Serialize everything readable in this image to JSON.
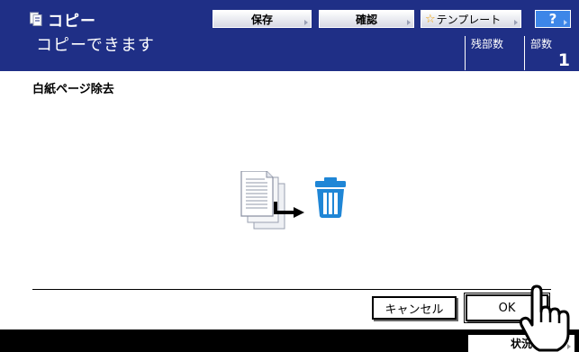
{
  "header": {
    "app_title": "コピー",
    "status_message": "コピーできます",
    "buttons": {
      "save": "保存",
      "check": "確認",
      "template_star": "☆",
      "template": "テンプレート",
      "help": "?"
    },
    "counters": {
      "remaining_label": "残部数",
      "copies_label": "部数",
      "copies_value": "1"
    }
  },
  "main": {
    "function_title": "白紙ページ除去",
    "cancel_label": "キャンセル",
    "ok_label": "OK"
  },
  "footer": {
    "job_status_label": "状況"
  },
  "colors": {
    "header_bg": "#1f2f86",
    "help_button": "#3d86e8",
    "icon_blue": "#1f86d6"
  }
}
